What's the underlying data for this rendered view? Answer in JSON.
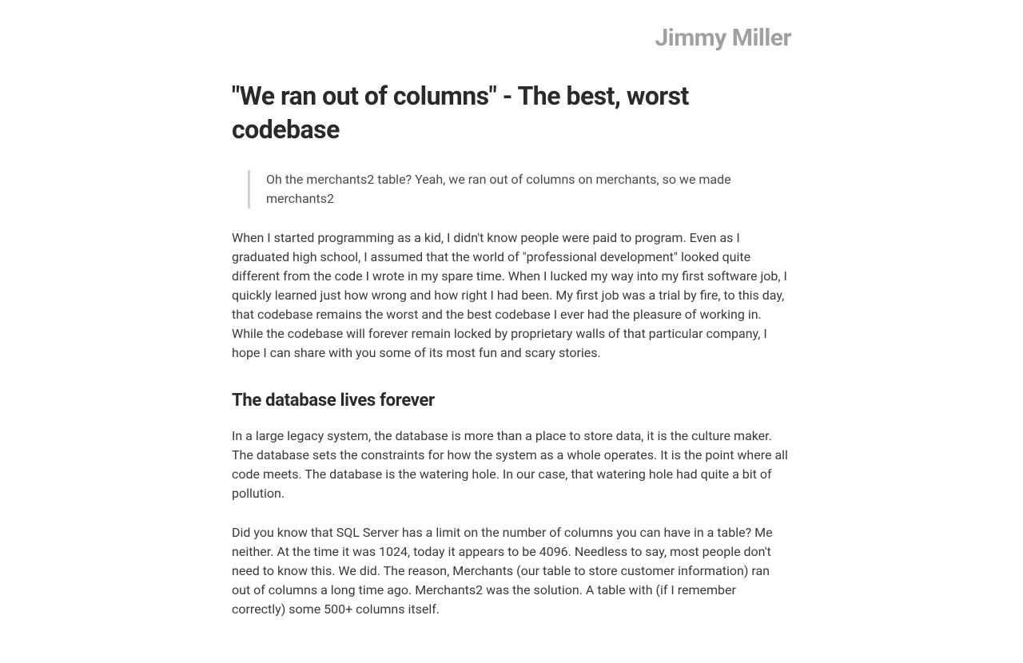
{
  "site": {
    "name": "Jimmy Miller"
  },
  "article": {
    "title": "\"We ran out of columns\" - The best, worst codebase",
    "quote": "Oh the merchants2 table? Yeah, we ran out of columns on merchants, so we made merchants2",
    "intro": "When I started programming as a kid, I didn't know people were paid to program. Even as I graduated high school, I assumed that the world of \"professional development\" looked quite different from the code I wrote in my spare time. When I lucked my way into my first software job, I quickly learned just how wrong and how right I had been. My first job was a trial by fire, to this day, that codebase remains the worst and the best codebase I ever had the pleasure of working in. While the codebase will forever remain locked by proprietary walls of that particular company, I hope I can share with you some of its most fun and scary stories.",
    "sections": [
      {
        "heading": "The database lives forever",
        "paragraphs": [
          "In a large legacy system, the database is more than a place to store data, it is the culture maker. The database sets the constraints for how the system as a whole operates. It is the point where all code meets. The database is the watering hole. In our case, that watering hole had quite a bit of pollution.",
          "Did you know that SQL Server has a limit on the number of columns you can have in a table? Me neither. At the time it was 1024, today it appears to be 4096. Needless to say, most people don't need to know this. We did. The reason, Merchants (our table to store customer information) ran out of columns a long time ago. Merchants2 was the solution. A table with (if I remember correctly) some 500+ columns itself."
        ]
      }
    ]
  }
}
